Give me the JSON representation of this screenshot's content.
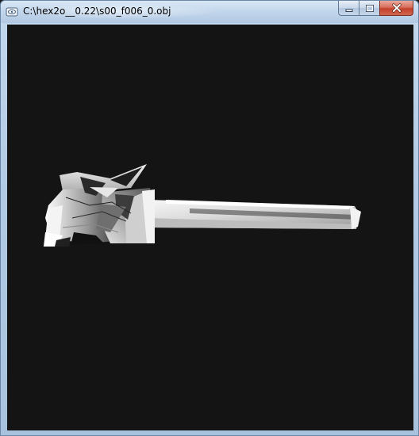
{
  "window": {
    "title": "C:\\hex2o__0.22\\s00_f006_0.obj",
    "icon": "app-window-icon"
  },
  "caption_buttons": {
    "minimize_icon": "minimize-icon",
    "maximize_icon": "maximize-icon",
    "close_icon": "close-icon"
  },
  "colors": {
    "viewport_background": "#141414",
    "close_button": "#c3412a",
    "titlebar": "#c3d7ec"
  }
}
